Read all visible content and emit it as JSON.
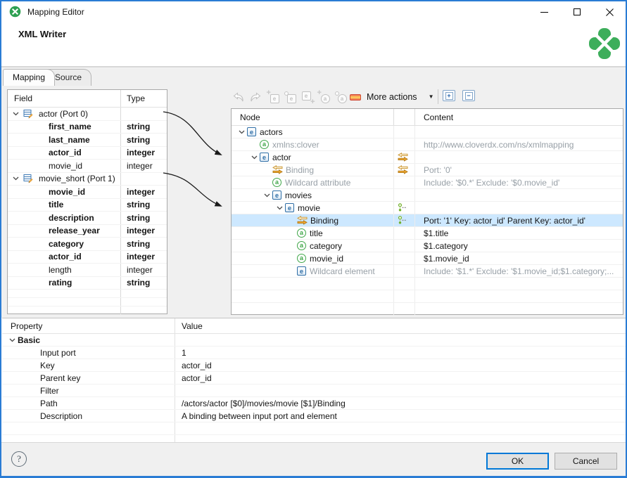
{
  "window": {
    "title": "Mapping Editor",
    "heading": "XML Writer"
  },
  "tabs": {
    "mapping": "Mapping",
    "source": "Source"
  },
  "toolbar": {
    "more_actions_label": "More actions",
    "icon_names": [
      "undo",
      "redo",
      "add-child-element",
      "add-element-before",
      "add-element-after",
      "add-attribute",
      "add-wildcard-attribute",
      "remove",
      "expand-all",
      "collapse-all"
    ]
  },
  "icons": {
    "element_letter": "e",
    "attribute_letter": "a",
    "expand_glyph": "+",
    "collapse_glyph": "−",
    "dropdown_glyph": "▼"
  },
  "field_table": {
    "headers": {
      "field": "Field",
      "type": "Type"
    },
    "rows": [
      {
        "label": "actor (Port 0)",
        "type": ""
      },
      {
        "label": "first_name",
        "type": "string"
      },
      {
        "label": "last_name",
        "type": "string"
      },
      {
        "label": "actor_id",
        "type": "integer"
      },
      {
        "label": "movie_id",
        "type": "integer"
      },
      {
        "label": "movie_short (Port 1)",
        "type": ""
      },
      {
        "label": "movie_id",
        "type": "integer"
      },
      {
        "label": "title",
        "type": "string"
      },
      {
        "label": "description",
        "type": "string"
      },
      {
        "label": "release_year",
        "type": "integer"
      },
      {
        "label": "category",
        "type": "string"
      },
      {
        "label": "actor_id",
        "type": "integer"
      },
      {
        "label": "length",
        "type": "integer"
      },
      {
        "label": "rating",
        "type": "string"
      }
    ]
  },
  "tree": {
    "headers": {
      "node": "Node",
      "content": "Content"
    },
    "rows": [
      {
        "label": "actors",
        "content": ""
      },
      {
        "label": "xmlns:clover",
        "content": "http://www.cloverdx.com/ns/xmlmapping"
      },
      {
        "label": "actor",
        "content": ""
      },
      {
        "label": "Binding",
        "content": "Port: '0'"
      },
      {
        "label": "Wildcard attribute",
        "content": "Include: '$0.*' Exclude: '$0.movie_id'"
      },
      {
        "label": "movies",
        "content": ""
      },
      {
        "label": "movie",
        "content": ""
      },
      {
        "label": "Binding",
        "content": "Port: '1' Key: actor_id' Parent Key: actor_id'"
      },
      {
        "label": "title",
        "content": "$1.title"
      },
      {
        "label": "category",
        "content": "$1.category"
      },
      {
        "label": "movie_id",
        "content": "$1.movie_id"
      },
      {
        "label": "Wildcard element",
        "content": "Include: '$1.*' Exclude: '$1.movie_id;$1.category;..."
      }
    ]
  },
  "properties": {
    "headers": {
      "property": "Property",
      "value": "Value"
    },
    "group_label": "Basic",
    "rows": [
      {
        "name": "Input port",
        "value": "1"
      },
      {
        "name": "Key",
        "value": "actor_id"
      },
      {
        "name": "Parent key",
        "value": "actor_id"
      },
      {
        "name": "Filter",
        "value": ""
      },
      {
        "name": "Path",
        "value": "/actors/actor [$0]/movies/movie [$1]/Binding"
      },
      {
        "name": "Description",
        "value": "A binding between input port and element"
      }
    ]
  },
  "footer": {
    "ok_label": "OK",
    "cancel_label": "Cancel",
    "help_glyph": "?"
  },
  "colors": {
    "accent_blue": "#0078d7",
    "selection_blue": "#cde8ff",
    "element_blue": "#2e6ea6",
    "attribute_green": "#3fa648",
    "binding_orange": "#eeb14a",
    "logo_green": "#3dae5b",
    "window_border": "#2a7cd4",
    "muted_text": "#98a0a7"
  }
}
